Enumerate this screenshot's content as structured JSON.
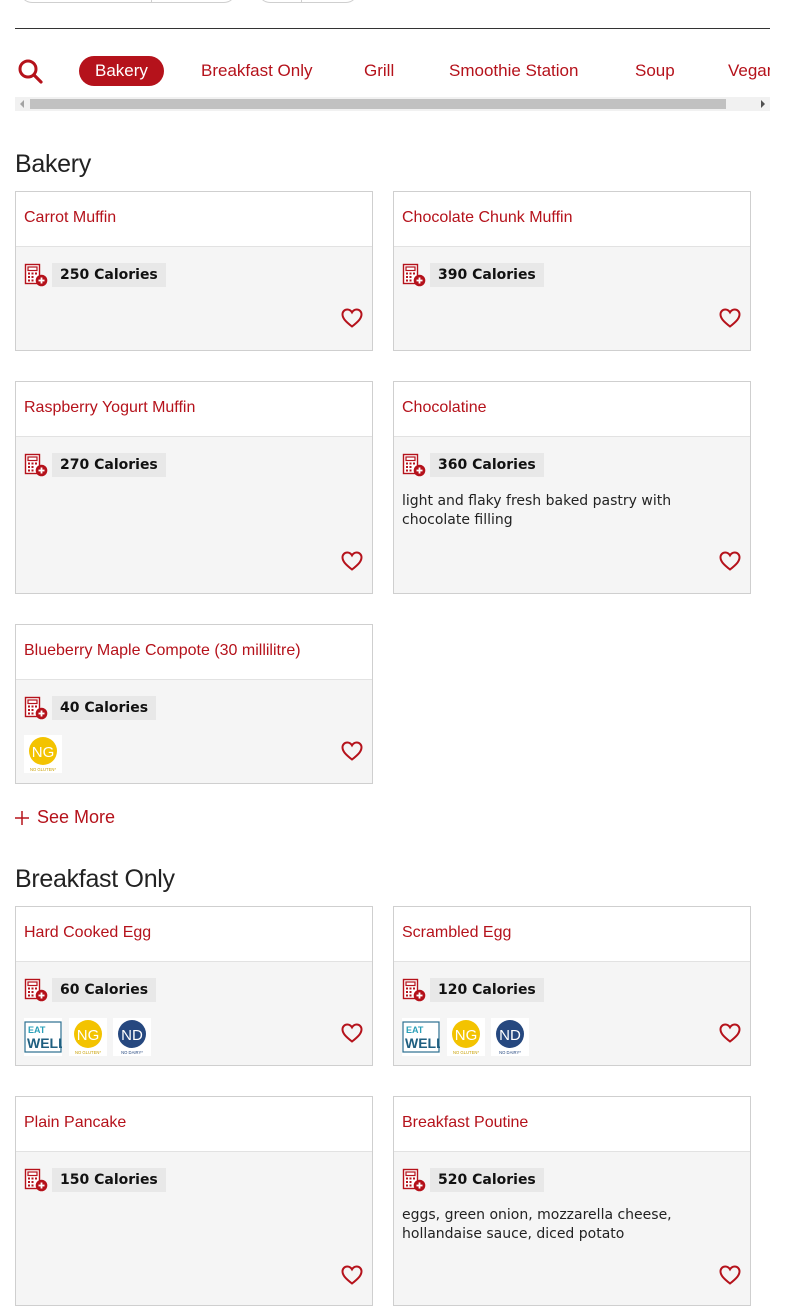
{
  "nav": {
    "search_icon": "search-icon",
    "tabs": [
      {
        "label": "Bakery",
        "active": true
      },
      {
        "label": "Breakfast Only",
        "active": false
      },
      {
        "label": "Grill",
        "active": false
      },
      {
        "label": "Smoothie Station",
        "active": false
      },
      {
        "label": "Soup",
        "active": false
      },
      {
        "label": "Vegan",
        "active": false
      }
    ]
  },
  "colors": {
    "accent": "#b5121b",
    "card_bg": "#f5f5f5",
    "border": "#cfcfcf"
  },
  "sections": [
    {
      "title": "Bakery",
      "items": [
        {
          "name": "Carrot Muffin",
          "calories": "250 Calories",
          "description": "",
          "badges": []
        },
        {
          "name": "Chocolate Chunk Muffin",
          "calories": "390 Calories",
          "description": "",
          "badges": []
        },
        {
          "name": "Raspberry Yogurt Muffin",
          "calories": "270 Calories",
          "description": "",
          "badges": []
        },
        {
          "name": "Chocolatine",
          "calories": "360 Calories",
          "description": "light and flaky fresh baked pastry with chocolate filling",
          "badges": []
        },
        {
          "name": "Blueberry Maple Compote (30 millilitre)",
          "calories": "40 Calories",
          "description": "",
          "badges": [
            "no-gluten"
          ]
        }
      ],
      "see_more": "See More"
    },
    {
      "title": "Breakfast Only",
      "items": [
        {
          "name": "Hard Cooked Egg",
          "calories": "60 Calories",
          "description": "",
          "badges": [
            "eat-well",
            "no-gluten",
            "no-dairy"
          ]
        },
        {
          "name": "Scrambled Egg",
          "calories": "120 Calories",
          "description": "",
          "badges": [
            "eat-well",
            "no-gluten",
            "no-dairy"
          ]
        },
        {
          "name": "Plain Pancake",
          "calories": "150 Calories",
          "description": "",
          "badges": []
        },
        {
          "name": "Breakfast Poutine",
          "calories": "520 Calories",
          "description": "eggs, green onion, mozzarella cheese, hollandaise sauce, diced potato",
          "badges": []
        }
      ]
    }
  ],
  "badge_labels": {
    "eat_well_top": "EAT",
    "eat_well_bottom": "WELL",
    "ng": "NG",
    "ng_sub": "NO GLUTEN*",
    "nd": "ND",
    "nd_sub": "NO DAIRY*"
  }
}
